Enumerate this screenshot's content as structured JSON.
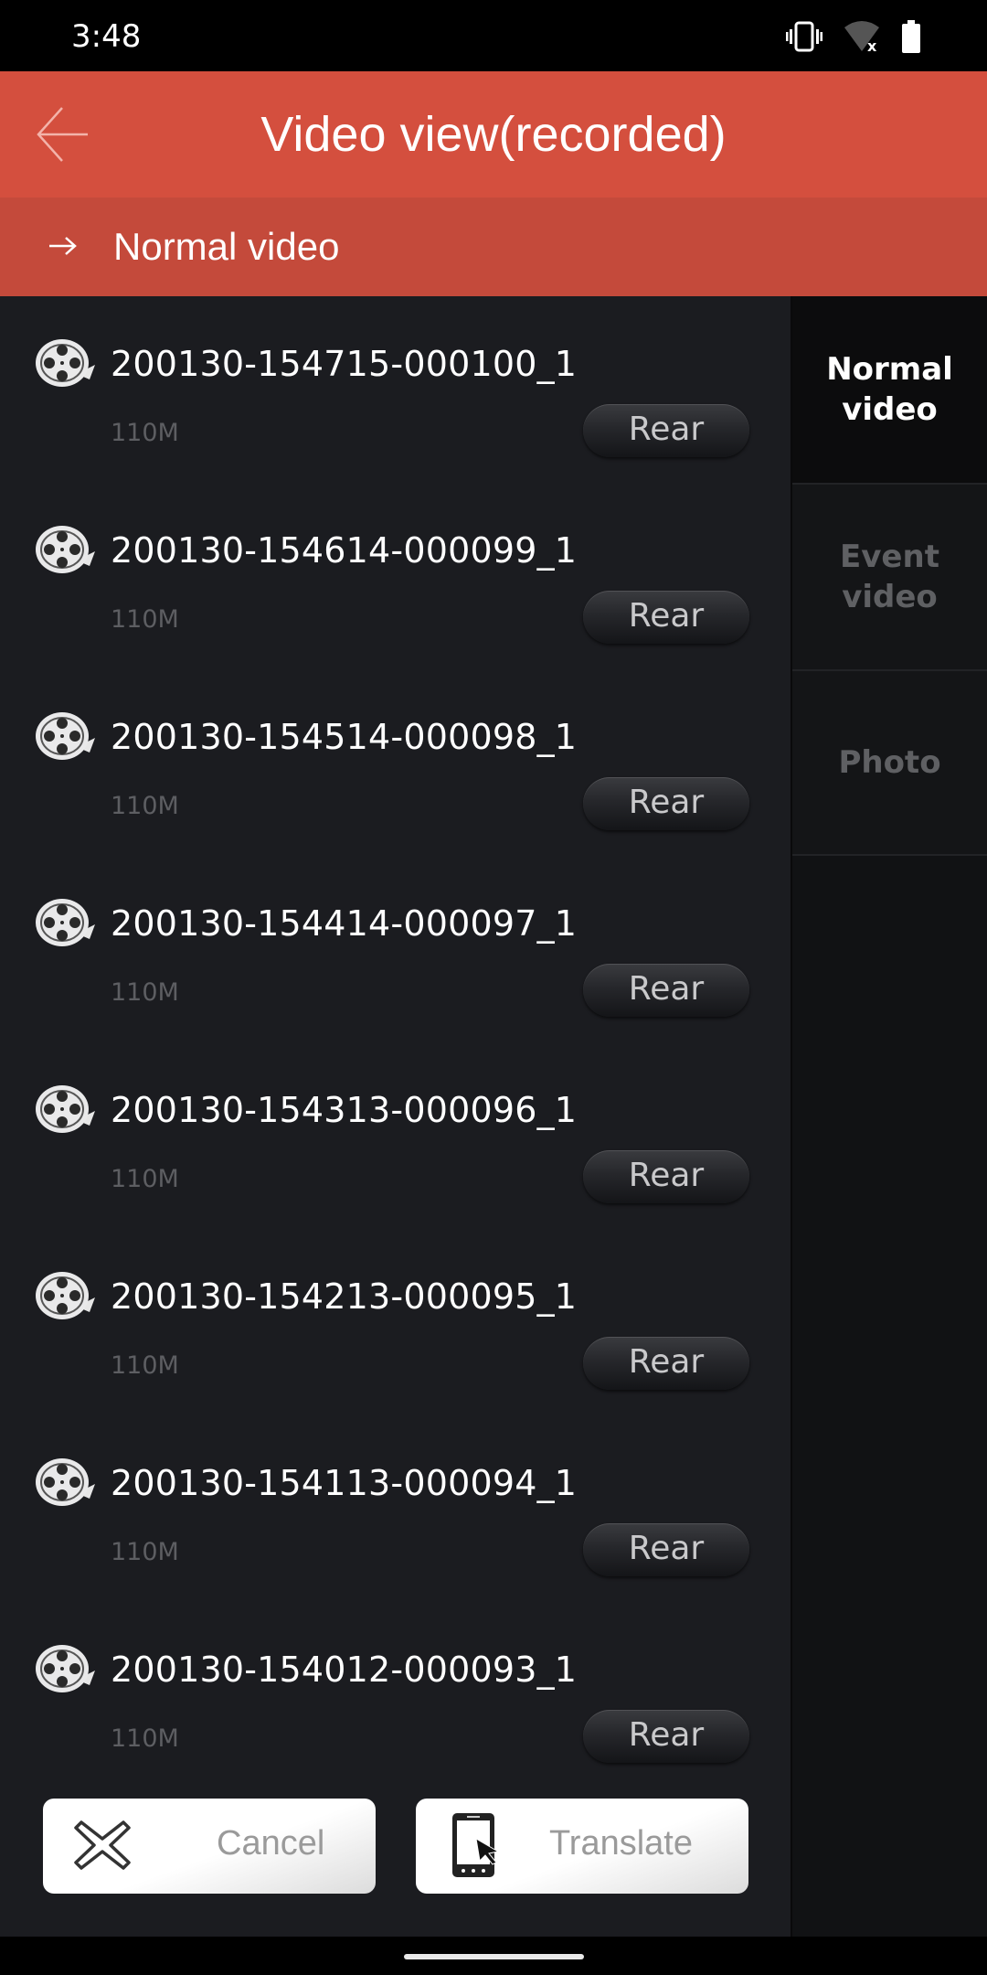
{
  "status_bar": {
    "time": "3:48",
    "icons": [
      "vibrate-icon",
      "wifi-off-icon",
      "battery-full-icon"
    ]
  },
  "header": {
    "title": "Video view(recorded)",
    "back_icon": "back-arrow-icon"
  },
  "subheader": {
    "arrow_icon": "right-arrow-icon",
    "title": "Normal video"
  },
  "files": [
    {
      "name": "200130-154715-000100_1",
      "size": "110M",
      "action": "Rear"
    },
    {
      "name": "200130-154614-000099_1",
      "size": "110M",
      "action": "Rear"
    },
    {
      "name": "200130-154514-000098_1",
      "size": "110M",
      "action": "Rear"
    },
    {
      "name": "200130-154414-000097_1",
      "size": "110M",
      "action": "Rear"
    },
    {
      "name": "200130-154313-000096_1",
      "size": "110M",
      "action": "Rear"
    },
    {
      "name": "200130-154213-000095_1",
      "size": "110M",
      "action": "Rear"
    },
    {
      "name": "200130-154113-000094_1",
      "size": "110M",
      "action": "Rear"
    },
    {
      "name": "200130-154012-000093_1",
      "size": "110M",
      "action": "Rear"
    }
  ],
  "sidebar": {
    "tabs": [
      {
        "label": "Normal video",
        "active": true
      },
      {
        "label": "Event video",
        "active": false
      },
      {
        "label": "Photo",
        "active": false
      }
    ]
  },
  "actions": {
    "cancel_label": "Cancel",
    "translate_label": "Translate"
  },
  "colors": {
    "header": "#d44f3e",
    "subheader": "#c44a3b",
    "list_bg": "#1b1c20",
    "sidebar_bg": "#111214"
  }
}
